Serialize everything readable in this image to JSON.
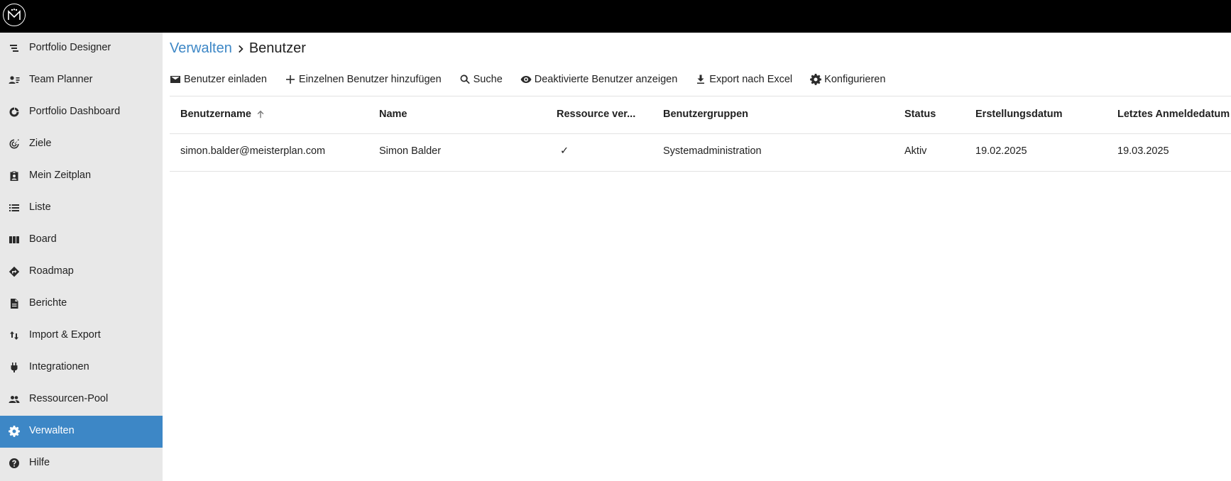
{
  "app": {
    "logo_icon": "meisterplan-logo",
    "accent_color": "#3d87c6"
  },
  "sidebar": {
    "items": [
      {
        "label": "Portfolio Designer",
        "icon": "portfolio-designer-icon"
      },
      {
        "label": "Team Planner",
        "icon": "team-planner-icon"
      },
      {
        "label": "Portfolio Dashboard",
        "icon": "dashboard-icon"
      },
      {
        "label": "Ziele",
        "icon": "target-icon"
      },
      {
        "label": "Mein Zeitplan",
        "icon": "badge-icon"
      },
      {
        "label": "Liste",
        "icon": "list-icon"
      },
      {
        "label": "Board",
        "icon": "board-icon"
      },
      {
        "label": "Roadmap",
        "icon": "roadmap-icon"
      },
      {
        "label": "Berichte",
        "icon": "document-icon"
      },
      {
        "label": "Import & Export",
        "icon": "import-export-icon"
      },
      {
        "label": "Integrationen",
        "icon": "plug-icon"
      },
      {
        "label": "Ressourcen-Pool",
        "icon": "people-icon"
      },
      {
        "label": "Verwalten",
        "icon": "gear-icon",
        "active": true
      },
      {
        "label": "Hilfe",
        "icon": "help-icon"
      }
    ]
  },
  "breadcrumb": {
    "parent": "Verwalten",
    "current": "Benutzer"
  },
  "toolbar": {
    "invite": "Benutzer einladen",
    "add_single": "Einzelnen Benutzer hinzufügen",
    "search": "Suche",
    "show_deactivated": "Deaktivierte Benutzer anzeigen",
    "export_excel": "Export nach Excel",
    "configure": "Konfigurieren"
  },
  "table": {
    "columns": [
      {
        "label": "Benutzername",
        "sorted": "ascending"
      },
      {
        "label": "Name"
      },
      {
        "label": "Ressource ver..."
      },
      {
        "label": "Benutzergruppen"
      },
      {
        "label": "Status"
      },
      {
        "label": "Erstellungsdatum"
      },
      {
        "label": "Letztes Anmeldedatum"
      }
    ],
    "rows": [
      {
        "username": "simon.balder@meisterplan.com",
        "name": "Simon Balder",
        "resource_linked": "✓",
        "groups": "Systemadministration",
        "status": "Aktiv",
        "created": "19.02.2025",
        "last_login": "19.03.2025"
      }
    ]
  }
}
